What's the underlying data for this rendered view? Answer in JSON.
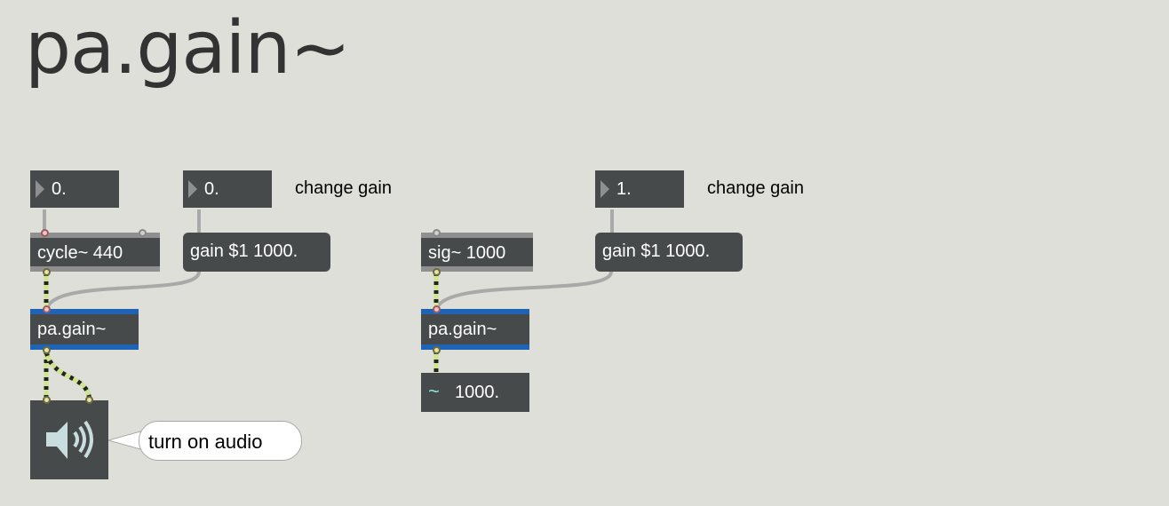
{
  "title": "pa.gain~",
  "left_patch": {
    "freq_number": "0.",
    "gain_number": "0.",
    "comment": "change gain",
    "oscillator": "cycle~ 440",
    "message": "gain $1 1000.",
    "gain_object": "pa.gain~",
    "speaker_comment": "turn on audio"
  },
  "right_patch": {
    "gain_number": "1.",
    "comment": "change gain",
    "signal": "sig~ 1000",
    "message": "gain $1 1000.",
    "gain_object": "pa.gain~",
    "meter_symbol": "~",
    "meter_value": "1000."
  },
  "colors": {
    "background": "#dfdfd9",
    "object": "#474a4a",
    "object_selected_border": "#1f63b5",
    "signal_cord": "#cfe58a",
    "control_cord": "#a9a9a9"
  }
}
